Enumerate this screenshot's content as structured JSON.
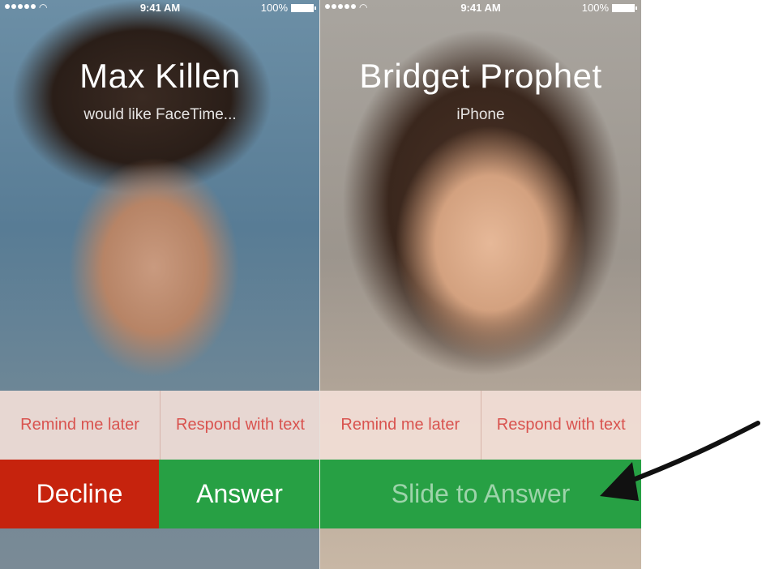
{
  "status_bar": {
    "time": "9:41 AM",
    "battery": "100%"
  },
  "screens": [
    {
      "caller_name": "Max Killen",
      "subtitle": "would like FaceTime...",
      "remind_label": "Remind me later",
      "respond_label": "Respond with text",
      "decline_label": "Decline",
      "answer_label": "Answer"
    },
    {
      "caller_name": "Bridget Prophet",
      "subtitle": "iPhone",
      "remind_label": "Remind me later",
      "respond_label": "Respond with text",
      "slide_label": "Slide to Answer"
    }
  ],
  "icons": [
    "signal-dots-icon",
    "wifi-icon",
    "battery-icon",
    "arrow-annotation-icon"
  ],
  "colors": {
    "decline": "#c6230d",
    "answer": "#27a044",
    "action_text": "#d9534f"
  }
}
